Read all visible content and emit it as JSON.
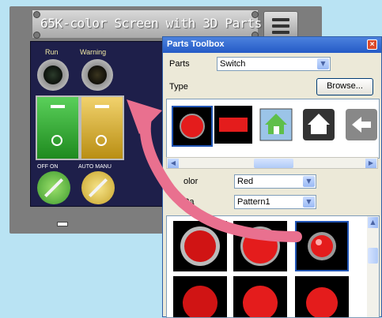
{
  "panel": {
    "title": "65K-color Screen with 3D Parts",
    "labels": {
      "run": "Run",
      "warning": "Warning",
      "off_on": "OFF  ON",
      "auto_manu": "AUTO MANU"
    }
  },
  "toolbox": {
    "title": "Parts Toolbox",
    "close_icon": "×",
    "parts_label": "Parts",
    "parts_value": "Switch",
    "type_label": "Type",
    "browse_label": "Browse...",
    "color_label": "olor",
    "color_value": "Red",
    "pattern_label": "Pa",
    "pattern_value": "Pattern1"
  },
  "colors": {
    "accent_arrow": "#e9708f",
    "titlebar": "#245ac6",
    "screen_bg": "#1e1f4a"
  },
  "icons": [
    "menu-icon",
    "close-icon",
    "chevron-down-icon",
    "chevron-left-icon",
    "chevron-right-icon",
    "chevron-up-icon",
    "home-icon",
    "back-arrow-icon"
  ]
}
